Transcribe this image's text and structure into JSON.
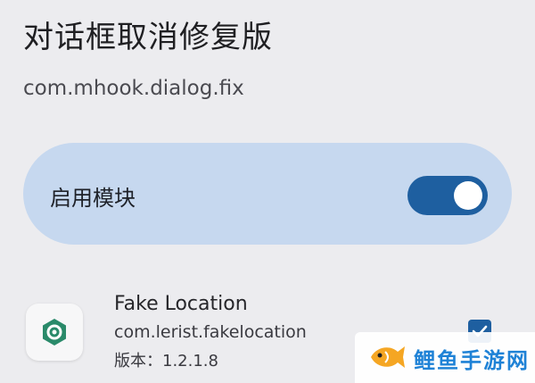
{
  "header": {
    "title": "对话框取消修复版",
    "package": "com.mhook.dialog.fix"
  },
  "enable_module": {
    "label": "启用模块",
    "enabled": true,
    "toggle_color": "#1e5fa0",
    "card_color": "#c6d8ef"
  },
  "app_item": {
    "name": "Fake Location",
    "package": "com.lerist.fakelocation",
    "version": "版本：1.2.1.8",
    "checked": true,
    "icon": "location-target-icon"
  },
  "watermark": {
    "text": "鲤鱼手游网",
    "icon": "fish-logo-icon"
  }
}
